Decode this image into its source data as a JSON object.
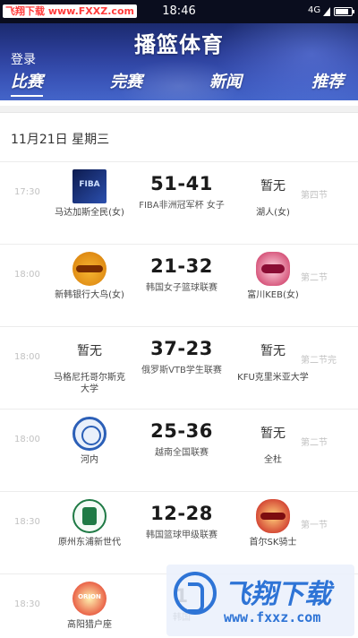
{
  "status_bar": {
    "watermark": "飞翔下载 www.FXXZ.com",
    "time": "18:46",
    "network": "4G",
    "battery_level": 0.8
  },
  "header": {
    "title": "播篮体育",
    "login_label": "登录",
    "tabs": [
      {
        "label": "比赛",
        "active": true
      },
      {
        "label": "完赛",
        "active": false
      },
      {
        "label": "新闻",
        "active": false
      },
      {
        "label": "推荐",
        "active": false
      }
    ]
  },
  "date_label": "11月21日 星期三",
  "matches": [
    {
      "time": "17:30",
      "home": "马达加斯全民(女)",
      "home_logo": "fiba-icon",
      "score": "51-41",
      "league": "FIBA非洲冠军杯 女子",
      "away": "湖人(女)",
      "away_logo": "暂无",
      "status": "第四节"
    },
    {
      "time": "18:00",
      "home": "新韩银行大鸟(女)",
      "home_logo": "shinhan-bank-logo",
      "score": "21-32",
      "league": "韩国女子篮球联赛",
      "away": "富川KEB(女)",
      "away_logo": "kb-stars-logo",
      "status": "第二节"
    },
    {
      "time": "18:00",
      "home": "马格尼托哥尔斯克大学",
      "home_logo": "暂无",
      "score": "37-23",
      "league": "俄罗斯VTB学生联赛",
      "away": "KFU克里米亚大学",
      "away_logo": "暂无",
      "status": "第二节完"
    },
    {
      "time": "18:00",
      "home": "河内",
      "home_logo": "hanoi-logo",
      "score": "25-36",
      "league": "越南全国联赛",
      "away": "全杜",
      "away_logo": "暂无",
      "status": "第二节"
    },
    {
      "time": "18:30",
      "home": "原州东浦新世代",
      "home_logo": "wonju-logo",
      "score": "12-28",
      "league": "韩国篮球甲级联赛",
      "away": "首尔SK骑士",
      "away_logo": "sk-knights-logo",
      "status": "第一节"
    },
    {
      "time": "18:30",
      "home": "高阳猎户座",
      "home_logo": "orion-logo",
      "score": "1",
      "league": "韩国",
      "away": "",
      "away_logo": "",
      "status": ""
    }
  ],
  "watermark_overlay": {
    "brand": "飞翔下载",
    "url": "www.fxxz.com"
  },
  "colors": {
    "header_top": "#1b2a6e",
    "header_bottom": "#4465c9",
    "accent_blue": "#2e74d6",
    "muted_text": "#c2c2c2"
  }
}
